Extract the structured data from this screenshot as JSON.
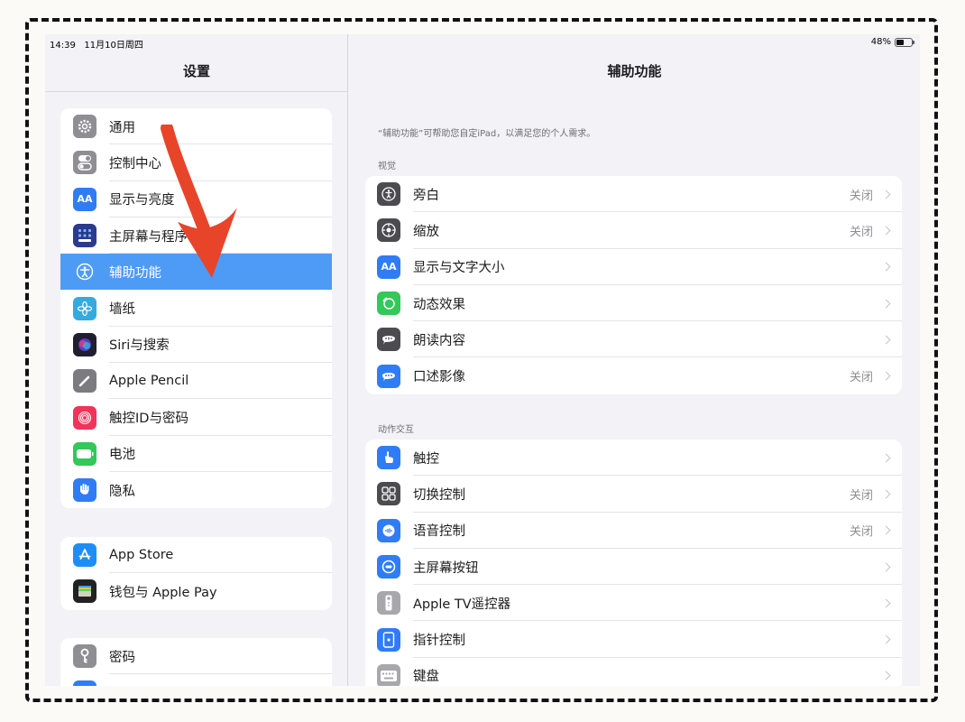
{
  "status_bar": {
    "time": "14:39",
    "date": "11月10日周四",
    "battery": "48%"
  },
  "sidebar": {
    "title": "设置",
    "groups": [
      {
        "items": [
          {
            "label": "通用",
            "icon": "gear-icon"
          },
          {
            "label": "控制中心",
            "icon": "toggles-icon"
          },
          {
            "label": "显示与亮度",
            "icon": "display-aa-icon"
          },
          {
            "label": "主屏幕与程序坞",
            "icon": "home-screen-grid-icon"
          },
          {
            "label": "辅助功能",
            "icon": "accessibility-icon",
            "selected": true
          },
          {
            "label": "墙纸",
            "icon": "wallpaper-flower-icon"
          },
          {
            "label": "Siri与搜索",
            "icon": "siri-icon"
          },
          {
            "label": "Apple Pencil",
            "icon": "pencil-icon"
          },
          {
            "label": "触控ID与密码",
            "icon": "fingerprint-icon"
          },
          {
            "label": "电池",
            "icon": "battery-icon"
          },
          {
            "label": "隐私",
            "icon": "hand-icon"
          }
        ]
      },
      {
        "items": [
          {
            "label": "App Store",
            "icon": "app-store-icon"
          },
          {
            "label": "钱包与 Apple Pay",
            "icon": "wallet-icon"
          }
        ]
      },
      {
        "items": [
          {
            "label": "密码",
            "icon": "key-icon"
          }
        ]
      }
    ]
  },
  "detail": {
    "title": "辅助功能",
    "description": "“辅助功能”可帮助您自定iPad，以满足您的个人需求。",
    "sections": [
      {
        "header": "视觉",
        "items": [
          {
            "label": "旁白",
            "value": "关闭",
            "icon": "voiceover-icon"
          },
          {
            "label": "缩放",
            "value": "关闭",
            "icon": "zoom-icon"
          },
          {
            "label": "显示与文字大小",
            "value": "",
            "icon": "text-size-aa-icon"
          },
          {
            "label": "动态效果",
            "value": "",
            "icon": "motion-icon"
          },
          {
            "label": "朗读内容",
            "value": "",
            "icon": "speech-bubble-icon"
          },
          {
            "label": "口述影像",
            "value": "关闭",
            "icon": "audio-description-icon"
          }
        ]
      },
      {
        "header": "动作交互",
        "items": [
          {
            "label": "触控",
            "value": "",
            "icon": "touch-hand-icon"
          },
          {
            "label": "切换控制",
            "value": "关闭",
            "icon": "switch-control-icon"
          },
          {
            "label": "语音控制",
            "value": "关闭",
            "icon": "voice-control-icon"
          },
          {
            "label": "主屏幕按钮",
            "value": "",
            "icon": "home-button-icon"
          },
          {
            "label": "Apple TV遥控器",
            "value": "",
            "icon": "remote-icon"
          },
          {
            "label": "指针控制",
            "value": "",
            "icon": "pointer-icon"
          },
          {
            "label": "键盘",
            "value": "",
            "icon": "keyboard-icon"
          }
        ]
      }
    ]
  },
  "colors": {
    "selected_row": "#4e9bf6",
    "annotation_arrow": "#e8442a",
    "system_blue": "#2f7cf6"
  }
}
